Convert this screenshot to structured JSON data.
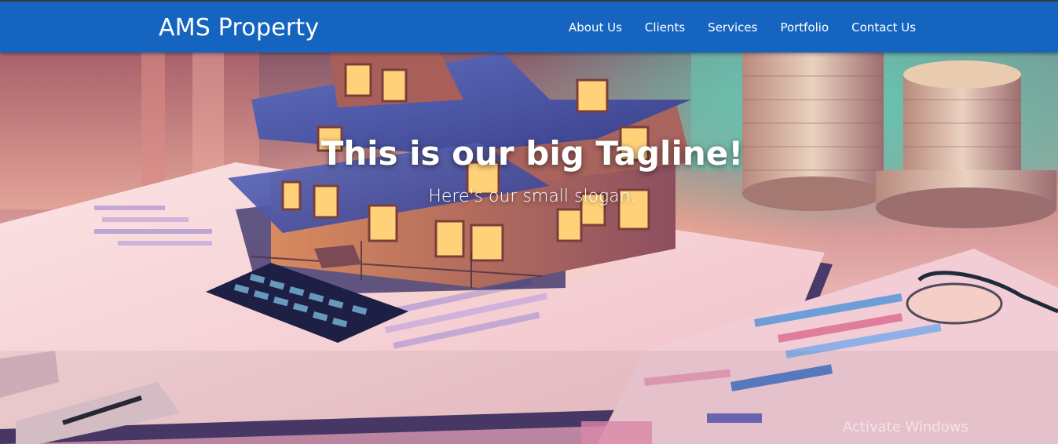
{
  "navbar": {
    "brand": "AMS Property",
    "links": [
      "About Us",
      "Clients",
      "Services",
      "Portfolio",
      "Contact Us"
    ],
    "background": "#1565c0"
  },
  "hero": {
    "tagline": "This is our big Tagline!",
    "slogan": "Here's our small slogan."
  },
  "system": {
    "watermark": "Activate Windows"
  }
}
